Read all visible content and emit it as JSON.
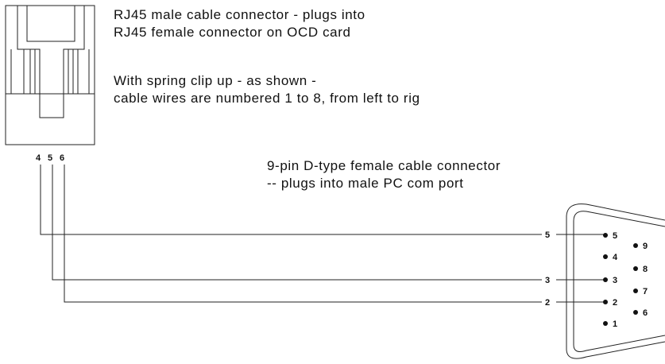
{
  "rj45": {
    "title_line1": "RJ45 male cable connector - plugs into",
    "title_line2": "RJ45 female connector on OCD card",
    "note_line1": "With spring clip up - as shown -",
    "note_line2": "cable wires are numbered 1 to 8, from left to rig",
    "pin_labels": [
      "4",
      "5",
      "6"
    ]
  },
  "db9": {
    "title_line1": "9-pin D-type female cable connector",
    "title_line2": " -- plugs into male PC com port",
    "top_row_pins": [
      "5",
      "4",
      "3",
      "2",
      "1"
    ],
    "bottom_row_pins": [
      "9",
      "8",
      "7",
      "6"
    ]
  },
  "wires": [
    {
      "from_pin": "4",
      "to_pin": "5",
      "label": "5"
    },
    {
      "from_pin": "5",
      "to_pin": "3",
      "label": "3"
    },
    {
      "from_pin": "6",
      "to_pin": "2",
      "label": "2"
    }
  ]
}
